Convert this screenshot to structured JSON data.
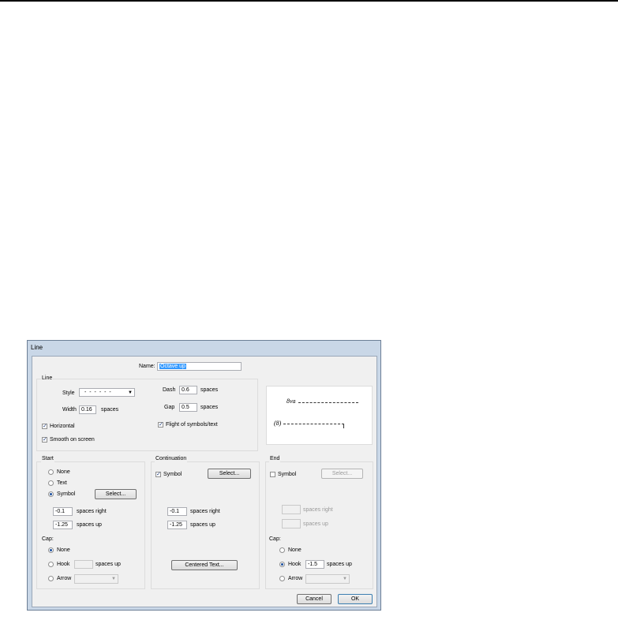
{
  "dialog": {
    "title": "Line"
  },
  "name": {
    "label": "Name:",
    "value": "Octave up"
  },
  "line_group": {
    "label": "Line",
    "style_label": "Style",
    "style_value": "- - - - - -",
    "width_label": "Width",
    "width_value": "0.16",
    "width_unit": "spaces",
    "dash_label": "Dash",
    "dash_value": "0.6",
    "dash_unit": "spaces",
    "gap_label": "Gap",
    "gap_value": "0.5",
    "gap_unit": "spaces",
    "horizontal_label": "Horizontal",
    "horizontal_checked": true,
    "smooth_label": "Smooth on screen",
    "smooth_checked": true,
    "flight_label": "Flight of symbols/text",
    "flight_checked": true
  },
  "preview": {
    "top_text": "8va",
    "bottom_text": "(8)"
  },
  "start": {
    "label": "Start",
    "none_label": "None",
    "text_label": "Text",
    "symbol_label": "Symbol",
    "selected": "Symbol",
    "select_button": "Select...",
    "right_value": "-0.1",
    "right_label": "spaces right",
    "up_value": "-1.25",
    "up_label": "spaces up",
    "cap_label": "Cap:",
    "cap_none": "None",
    "cap_hook": "Hook",
    "cap_hook_value": "",
    "cap_hook_unit": "spaces up",
    "cap_arrow": "Arrow",
    "cap_selected": "None"
  },
  "continuation": {
    "label": "Continuation",
    "symbol_label": "Symbol",
    "symbol_checked": true,
    "select_button": "Select...",
    "right_value": "-0.1",
    "right_label": "spaces right",
    "up_value": "-1.25",
    "up_label": "spaces up",
    "centered_button": "Centered Text..."
  },
  "end": {
    "label": "End",
    "symbol_label": "Symbol",
    "symbol_checked": false,
    "select_button": "Select...",
    "right_value": "",
    "right_label": "spaces right",
    "up_value": "",
    "up_label": "spaces up",
    "cap_label": "Cap:",
    "cap_none": "None",
    "cap_hook": "Hook",
    "cap_hook_value": "-1.5",
    "cap_hook_unit": "spaces up",
    "cap_arrow": "Arrow",
    "cap_selected": "Hook"
  },
  "buttons": {
    "cancel": "Cancel",
    "ok": "OK"
  }
}
